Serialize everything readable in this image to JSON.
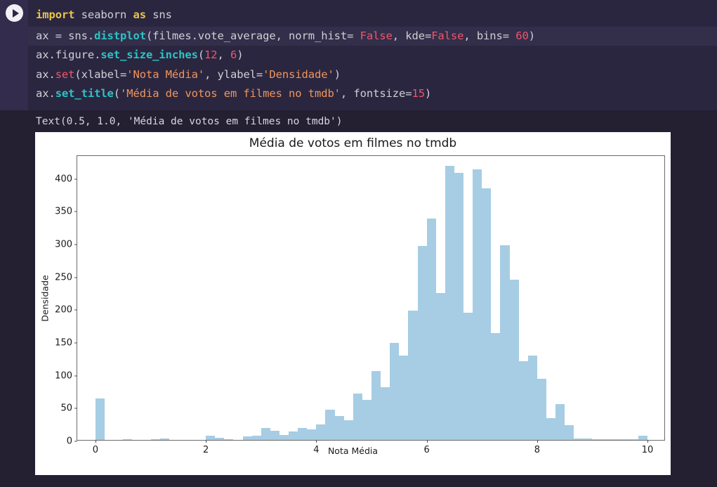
{
  "notebook": {
    "run_button_icon": "play-icon",
    "code_lines": [
      [
        {
          "t": "import",
          "c": "kw"
        },
        {
          "t": " seaborn ",
          "c": "plain"
        },
        {
          "t": "as",
          "c": "kw"
        },
        {
          "t": " sns",
          "c": "plain"
        }
      ],
      [
        {
          "t": "ax = sns.",
          "c": "plain"
        },
        {
          "t": "distplot",
          "c": "fn"
        },
        {
          "t": "(filmes.vote_average, norm_hist= ",
          "c": "plain"
        },
        {
          "t": "False",
          "c": "bool"
        },
        {
          "t": ", kde=",
          "c": "plain"
        },
        {
          "t": "False",
          "c": "bool"
        },
        {
          "t": ", bins= ",
          "c": "plain"
        },
        {
          "t": "60",
          "c": "num"
        },
        {
          "t": ")",
          "c": "plain"
        }
      ],
      [
        {
          "t": "ax.figure.",
          "c": "plain"
        },
        {
          "t": "set_size_inches",
          "c": "fn"
        },
        {
          "t": "(",
          "c": "plain"
        },
        {
          "t": "12",
          "c": "num"
        },
        {
          "t": ", ",
          "c": "plain"
        },
        {
          "t": "6",
          "c": "num"
        },
        {
          "t": ")",
          "c": "plain"
        }
      ],
      [
        {
          "t": "ax.",
          "c": "plain"
        },
        {
          "t": "set",
          "c": "fn2"
        },
        {
          "t": "(xlabel=",
          "c": "plain"
        },
        {
          "t": "'Nota Média'",
          "c": "str"
        },
        {
          "t": ", ylabel=",
          "c": "plain"
        },
        {
          "t": "'Densidade'",
          "c": "str"
        },
        {
          "t": ")",
          "c": "plain"
        }
      ],
      [
        {
          "t": "ax.",
          "c": "plain"
        },
        {
          "t": "set_title",
          "c": "fn"
        },
        {
          "t": "(",
          "c": "plain"
        },
        {
          "t": "'Média de votos em filmes no tmdb'",
          "c": "str"
        },
        {
          "t": ", fontsize=",
          "c": "plain"
        },
        {
          "t": "15",
          "c": "num"
        },
        {
          "t": ")",
          "c": "plain"
        }
      ]
    ],
    "output_text": "Text(0.5, 1.0, 'Média de votos em filmes no tmdb')"
  },
  "colors": {
    "bar": "#a6cde4",
    "editor_bg": "#2b2640",
    "notebook_bg": "#241f31",
    "gutter_bg": "#332c4d",
    "highlight_line": "#332e4a",
    "axis": "#6b6b6b",
    "text": "#cdd0d6"
  },
  "chart_data": {
    "type": "bar",
    "title": "Média de votos em filmes no tmdb",
    "xlabel": "Nota Média",
    "ylabel": "Densidade",
    "grid": false,
    "legend": null,
    "bins": 60,
    "bin_width": 0.1667,
    "xlim": [
      -0.33,
      10.33
    ],
    "ylim": [
      0,
      435
    ],
    "xticks": [
      0,
      2,
      4,
      6,
      8,
      10
    ],
    "yticks": [
      0,
      50,
      100,
      150,
      200,
      250,
      300,
      350,
      400
    ],
    "x": [
      0.083,
      0.25,
      0.417,
      0.583,
      0.75,
      0.917,
      1.083,
      1.25,
      1.417,
      1.583,
      1.75,
      1.917,
      2.083,
      2.25,
      2.417,
      2.583,
      2.75,
      2.917,
      3.083,
      3.25,
      3.417,
      3.583,
      3.75,
      3.917,
      4.083,
      4.25,
      4.417,
      4.583,
      4.75,
      4.917,
      5.083,
      5.25,
      5.417,
      5.583,
      5.75,
      5.917,
      6.083,
      6.25,
      6.417,
      6.583,
      6.75,
      6.917,
      7.083,
      7.25,
      7.417,
      7.583,
      7.75,
      7.917,
      8.083,
      8.25,
      8.417,
      8.583,
      8.75,
      8.917,
      9.083,
      9.25,
      9.417,
      9.583,
      9.75,
      9.917
    ],
    "values": [
      63,
      0,
      0,
      1,
      0,
      0,
      1,
      2,
      0,
      0,
      0,
      0,
      6,
      3,
      1,
      0,
      5,
      6,
      18,
      14,
      7,
      13,
      18,
      16,
      24,
      46,
      36,
      30,
      71,
      61,
      105,
      80,
      148,
      129,
      197,
      296,
      338,
      224,
      418,
      407,
      194,
      413,
      384,
      163,
      297,
      244,
      120,
      129,
      93,
      33,
      55,
      22,
      2,
      2,
      1,
      1,
      1,
      1,
      1,
      6
    ],
    "notes": "Histogram of TMDB movie average vote, 60 bins, counts (norm_hist=False, kde=False)"
  }
}
